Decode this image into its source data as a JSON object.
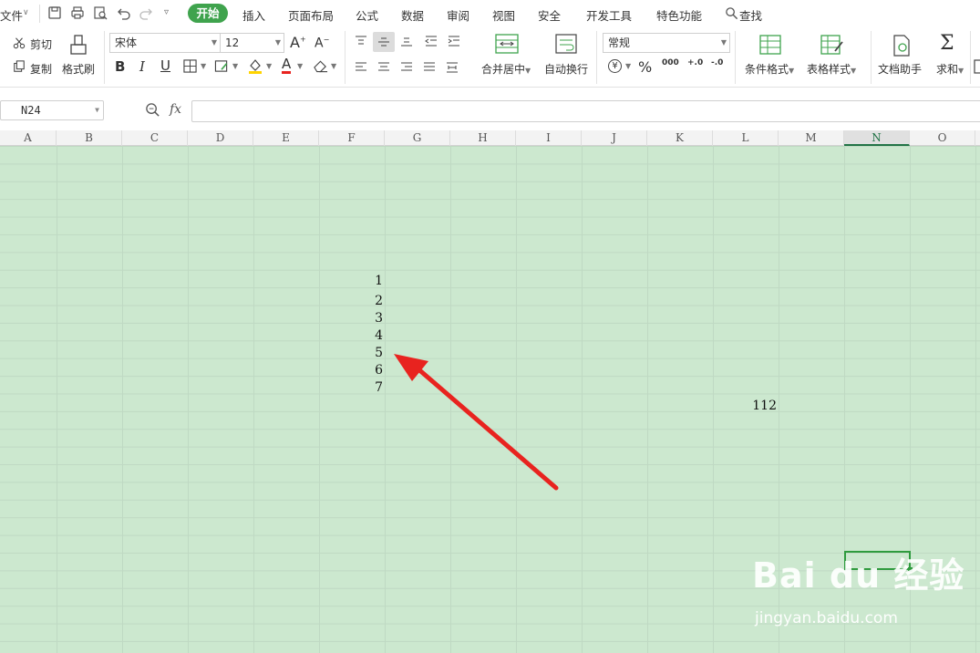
{
  "menu": {
    "file": "文件",
    "tabs": [
      "开始",
      "插入",
      "页面布局",
      "公式",
      "数据",
      "审阅",
      "视图",
      "安全",
      "开发工具",
      "特色功能"
    ],
    "active_tab": "开始",
    "search": "查找"
  },
  "ribbon": {
    "cut": "剪切",
    "copy": "复制",
    "format_painter": "格式刷",
    "font_name": "宋体",
    "font_size": "12",
    "merge_center": "合并居中",
    "wrap_text": "自动换行",
    "number_format": "常规",
    "conditional_format": "条件格式",
    "table_style": "表格样式",
    "doc_assistant": "文档助手",
    "sum": "求和",
    "bold": "B",
    "italic": "I",
    "underline": "U",
    "font_grow": "A",
    "font_shrink": "A",
    "percent": "%",
    "thousands": "000",
    "inc_decimal": "+.0",
    "dec_decimal": "-.0",
    "currency": "¥"
  },
  "formula_bar": {
    "name_box": "N24",
    "fx": "fx",
    "value": ""
  },
  "columns": [
    "A",
    "B",
    "C",
    "D",
    "E",
    "F",
    "G",
    "H",
    "I",
    "J",
    "K",
    "L",
    "M",
    "N",
    "O"
  ],
  "active_column": "N",
  "cells": {
    "f_values": [
      "1",
      "2",
      "3",
      "4",
      "5",
      "6",
      "7"
    ],
    "l_value": "112"
  },
  "watermark": {
    "brand": "Bai du 经验",
    "url": "jingyan.baidu.com"
  },
  "colors": {
    "accent_green": "#3fa34d",
    "grid_green": "#cce8cf",
    "arrow_red": "#e8231f"
  }
}
